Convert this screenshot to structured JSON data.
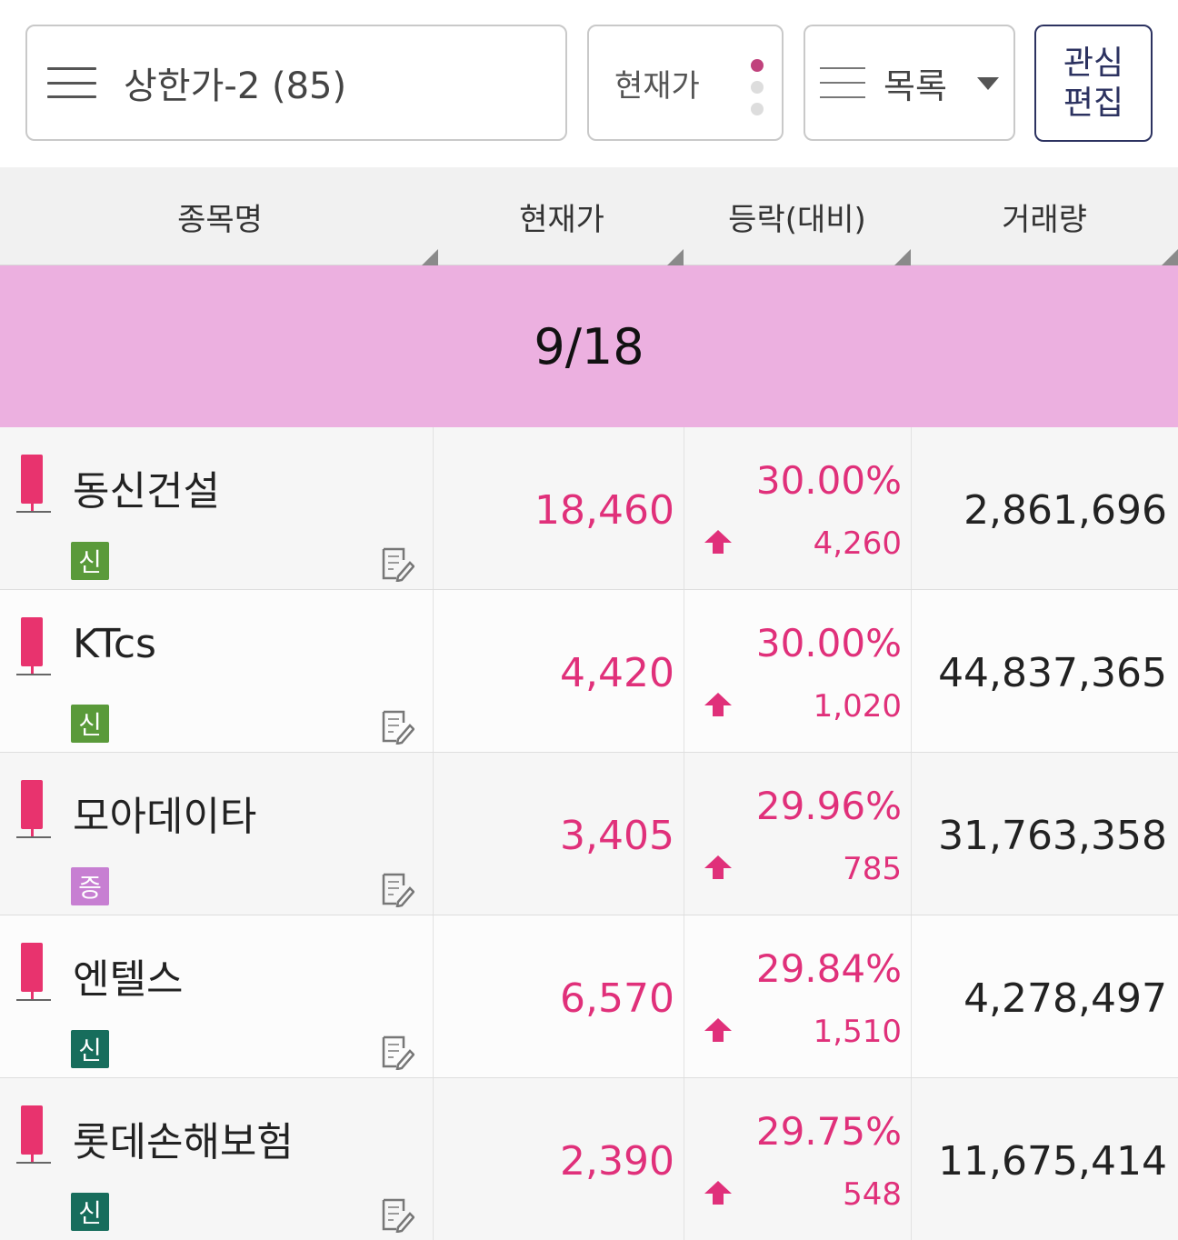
{
  "toolbar": {
    "list_title": "상한가-2 (85)",
    "price_toggle_label": "현재가",
    "view_label": "목록",
    "edit_line1": "관심",
    "edit_line2": "편집"
  },
  "columns": {
    "name": "종목명",
    "price": "현재가",
    "change": "등락(대비)",
    "volume": "거래량"
  },
  "banner": {
    "date": "9/18",
    "color": "#ecb0e0"
  },
  "colors": {
    "up": "#e0307a",
    "candle": "#e8336e",
    "badge_green": "#5a9a3a",
    "badge_teal": "#176d5c",
    "badge_purple": "#c77fd2"
  },
  "stocks": [
    {
      "name": "동신건설",
      "badge": "신",
      "badge_color": "#5a9a3a",
      "price": "18,460",
      "change_pct": "30.00%",
      "change_amt": "4,260",
      "volume": "2,861,696",
      "direction_icon": "up-arrow-icon"
    },
    {
      "name": "KTcs",
      "badge": "신",
      "badge_color": "#5a9a3a",
      "price": "4,420",
      "change_pct": "30.00%",
      "change_amt": "1,020",
      "volume": "44,837,365",
      "direction_icon": "up-arrow-icon"
    },
    {
      "name": "모아데이타",
      "badge": "증",
      "badge_color": "#c77fd2",
      "price": "3,405",
      "change_pct": "29.96%",
      "change_amt": "785",
      "volume": "31,763,358",
      "direction_icon": "up-arrow-icon"
    },
    {
      "name": "엔텔스",
      "badge": "신",
      "badge_color": "#176d5c",
      "price": "6,570",
      "change_pct": "29.84%",
      "change_amt": "1,510",
      "volume": "4,278,497",
      "direction_icon": "up-arrow-icon"
    },
    {
      "name": "롯데손해보험",
      "badge": "신",
      "badge_color": "#176d5c",
      "price": "2,390",
      "change_pct": "29.75%",
      "change_amt": "548",
      "volume": "11,675,414",
      "direction_icon": "up-arrow-icon"
    }
  ]
}
